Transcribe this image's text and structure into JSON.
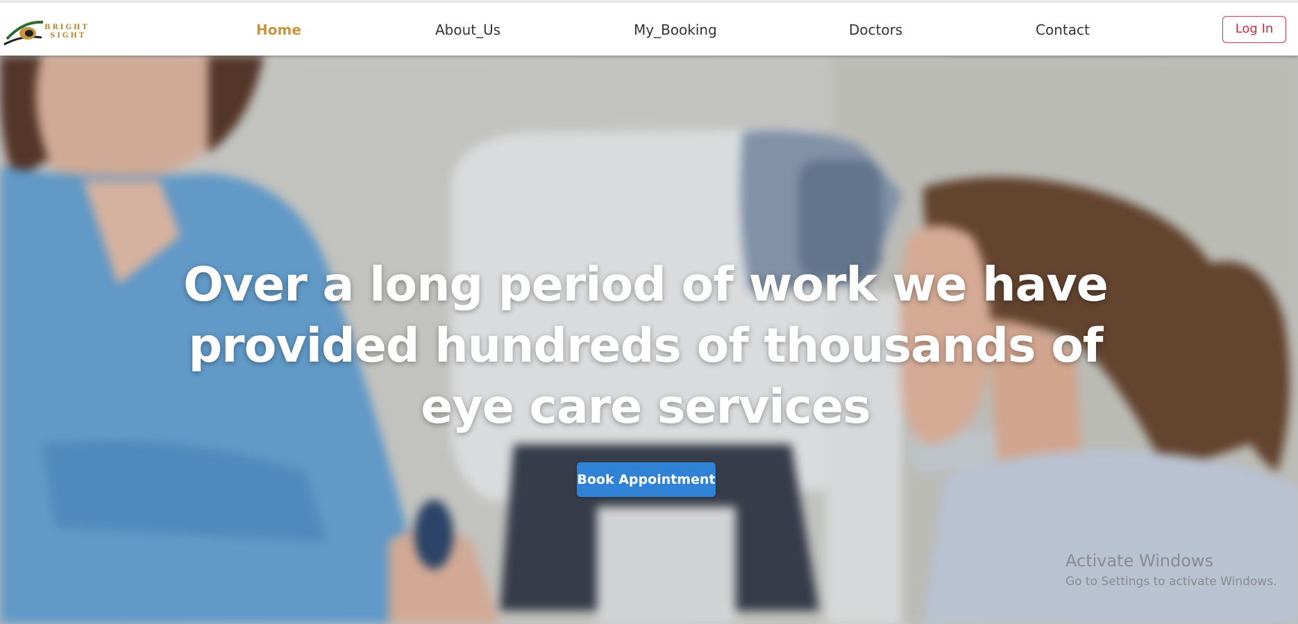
{
  "brand": {
    "line1": "BRIGHT",
    "line2": "SIGHT",
    "accent": "#b7862e"
  },
  "nav": {
    "items": [
      {
        "label": "Home",
        "active": true
      },
      {
        "label": "About_Us",
        "active": false
      },
      {
        "label": "My_Booking",
        "active": false
      },
      {
        "label": "Doctors",
        "active": false
      },
      {
        "label": "Contact",
        "active": false
      }
    ],
    "login_label": "Log In",
    "active_color": "#c9963f",
    "login_color": "#c22d3e"
  },
  "hero": {
    "headline": "Over a long period of work we have provided hundreds of thousands of eye care services",
    "cta_label": "Book Appointment",
    "cta_color": "#2f82d6"
  },
  "watermark": {
    "title": "Activate Windows",
    "subtitle": "Go to Settings to activate Windows."
  }
}
